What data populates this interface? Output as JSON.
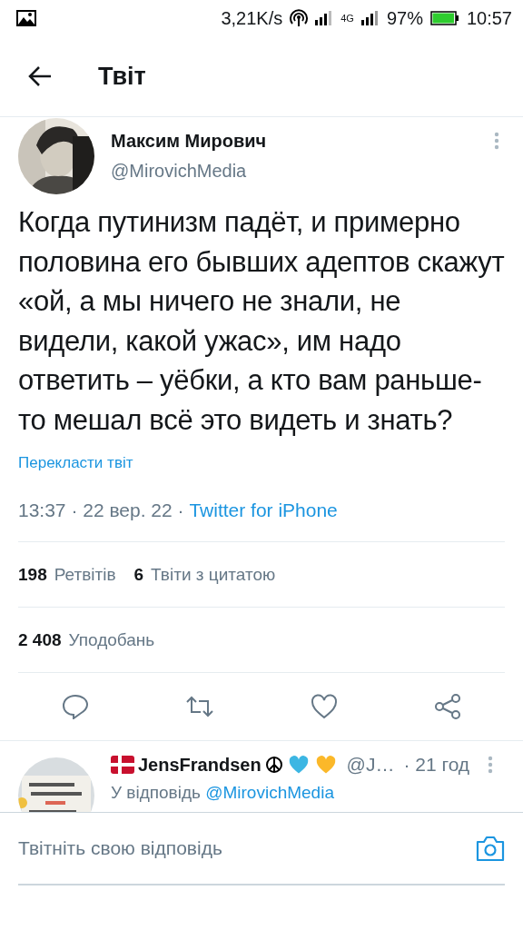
{
  "status_bar": {
    "speed": "3,21K/s",
    "network": "4G",
    "battery": "97%",
    "time": "10:57"
  },
  "header": {
    "title": "Твіт"
  },
  "tweet": {
    "author": "Максим Мирович",
    "handle": "@MirovichMedia",
    "text": "Когда путинизм падёт, и примерно половина его бывших адептов скажут «ой, а мы ничего не знали, не видели, какой ужас», им надо ответить – уёбки, а кто вам раньше-то мешал всё это видеть и знать?",
    "translate": "Перекласти твіт",
    "time": "13:37 · 22 вер. 22 · ",
    "source": "Twitter for iPhone",
    "stats": [
      {
        "count": "198",
        "label": "Ретвітів"
      },
      {
        "count": "6",
        "label": "Твіти з цитатою"
      }
    ],
    "likes": {
      "count": "2 408",
      "label": "Уподобань"
    }
  },
  "reply": {
    "name": "JensFrandsen",
    "handle": "@J…",
    "time": "· 21 год",
    "replying_to": "У відповідь ",
    "mention": "@MirovichMedia"
  },
  "composer": {
    "placeholder": "Твітніть свою відповідь"
  }
}
